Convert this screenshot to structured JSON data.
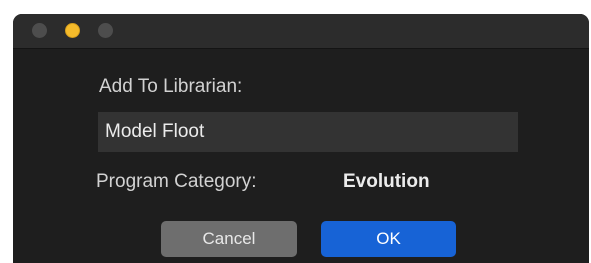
{
  "window": {
    "controls": [
      "close",
      "minimize",
      "zoom"
    ]
  },
  "form": {
    "add_label": "Add To Librarian:",
    "name_value": "Model Floot",
    "category_label": "Program Category:",
    "category_value": "Evolution"
  },
  "buttons": {
    "cancel_label": "Cancel",
    "ok_label": "OK"
  },
  "colors": {
    "background": "#1e1e1e",
    "titlebar": "#2c2c2c",
    "minimize_accent": "#f5bb2b",
    "primary_button": "#1763d6",
    "secondary_button": "#6e6e6e"
  }
}
